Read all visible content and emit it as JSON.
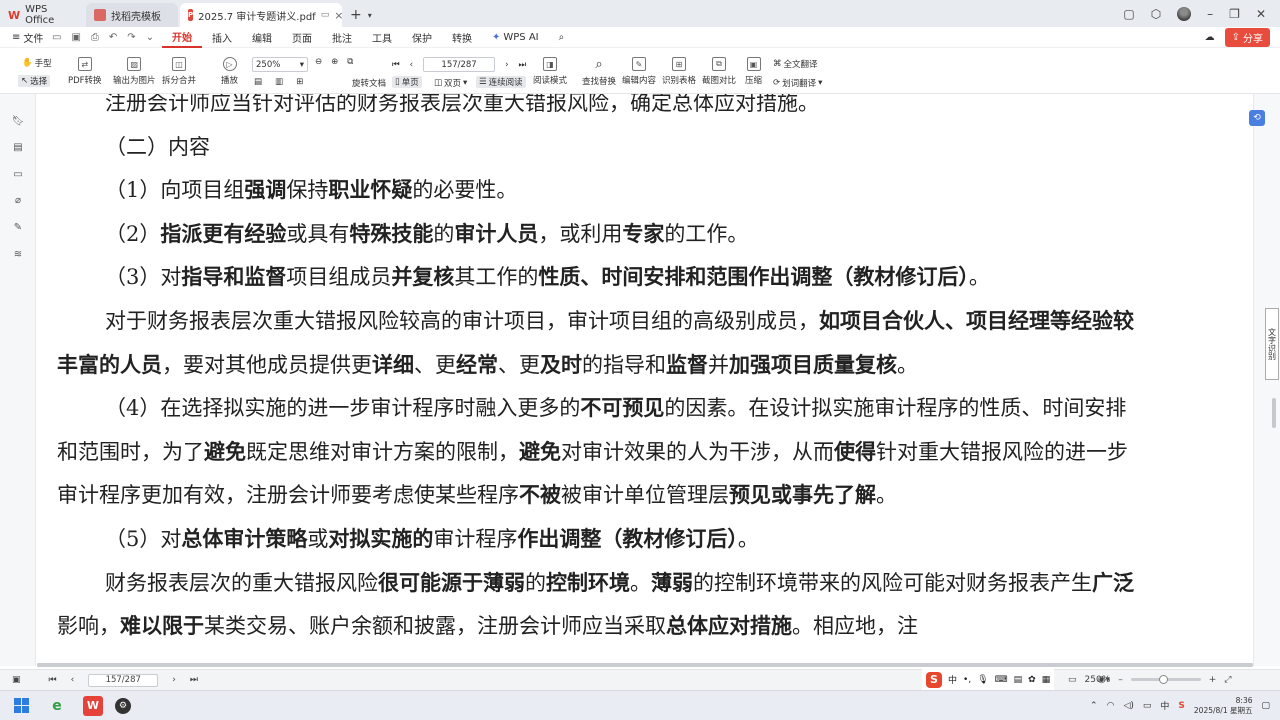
{
  "tabs": [
    {
      "label": "WPS Office"
    },
    {
      "label": "找稻壳模板"
    },
    {
      "label": "2025.7  审计专题讲义.pdf"
    }
  ],
  "menu": {
    "file": "文件",
    "items": [
      "开始",
      "插入",
      "编辑",
      "页面",
      "批注",
      "工具",
      "保护",
      "转换"
    ],
    "active": "开始",
    "wps_ai": "WPS AI",
    "share": "分享"
  },
  "ribbon": {
    "hand": "手型",
    "select": "选择",
    "pdf_convert": "PDF转换",
    "export_image": "输出为图片",
    "split_merge": "拆分合并",
    "play": "播放",
    "zoom": "250%",
    "page": "157/287",
    "rotate": "旋转文档",
    "single_page": "单页",
    "double_page": "双页",
    "continuous": "连续阅读",
    "read_mode": "阅读模式",
    "find_replace": "查找替换",
    "edit_content": "编辑内容",
    "recognize_table": "识别表格",
    "screenshot_compare": "截图对比",
    "compress": "压缩",
    "full_translate": "全文翻译",
    "word_translate": "划词翻译"
  },
  "document": {
    "top_partial": "注册会计师应当针对评估的财务报表层次重大错报风险，确定总体应对措施。",
    "heading": "（二）内容",
    "item1": {
      "a": "（1）向项目组",
      "b1": "强调",
      "c": "保持",
      "b2": "职业怀疑",
      "d": "的必要性。"
    },
    "item2": {
      "a": "（2）",
      "b1": "指派更有经验",
      "c": "或具有",
      "b2": "特殊技能",
      "d": "的",
      "b3": "审计人员",
      "e": "，或利用",
      "b4": "专家",
      "f": "的工作。"
    },
    "item3": {
      "a": "（3）对",
      "b1": "指导和监督",
      "c": "项目组成员",
      "b2": "并复核",
      "d": "其工作的",
      "b3": "性质、时间安排和范围作出调整（教材修订后）",
      "e": "。"
    },
    "para1": {
      "a": "对于财务报表层次重大错报风险较高的审计项目，审计项目组的高级别成员，",
      "b1": "如项目合伙人、项目经理等经验较丰富的人员",
      "c": "，要对其他成员提供更",
      "b2": "详细",
      "d": "、更",
      "b3": "经常",
      "e": "、更",
      "b4": "及时",
      "f": "的指导和",
      "b5": "监督",
      "g": "并",
      "b6": "加强项目质量复核",
      "h": "。"
    },
    "item4": {
      "a": "（4）在选择拟实施的进一步审计程序时融入更多的",
      "b1": "不可预见",
      "c": "的因素。在设计拟实施审计程序的性质、时间安排和范围时，为了",
      "b2": "避免",
      "d": "既定思维对审计方案的限制，",
      "b3": "避免",
      "e": "对审计效果的人为干涉，从而",
      "b4": "使得",
      "f": "针对重大错报风险的进一步审计程序更加有效，注册会计师要考虑使某些程序",
      "b5": "不被",
      "g": "被审计单位管理层",
      "b6": "预见或事先了解",
      "h": "。"
    },
    "item5": {
      "a": "（5）对",
      "b1": "总体审计策略",
      "c": "或",
      "b2": "对拟实施的",
      "d": "审计程序",
      "b3": "作出调整（教材修订后）",
      "e": "。"
    },
    "para2": {
      "a": "财务报表层次的重大错报风险",
      "b1": "很可能源于薄弱",
      "c": "的",
      "b2": "控制环境",
      "d": "。",
      "b3": "薄弱",
      "e": "的控制环境带来的风险可能对财务报表产生",
      "b4": "广泛",
      "f": "影响，",
      "b5": "难以限于",
      "g": "某类交易、账户余额和披露，注册会计师应当采取",
      "b6": "总体应对措施",
      "h": "。相应地，注"
    }
  },
  "sidetag": "文字识别",
  "status": {
    "page": "157/287",
    "zoom": "250%"
  },
  "ime": {
    "lang": "中"
  },
  "clock": {
    "time": "8:36",
    "date": "2025/8/1 星期五"
  }
}
